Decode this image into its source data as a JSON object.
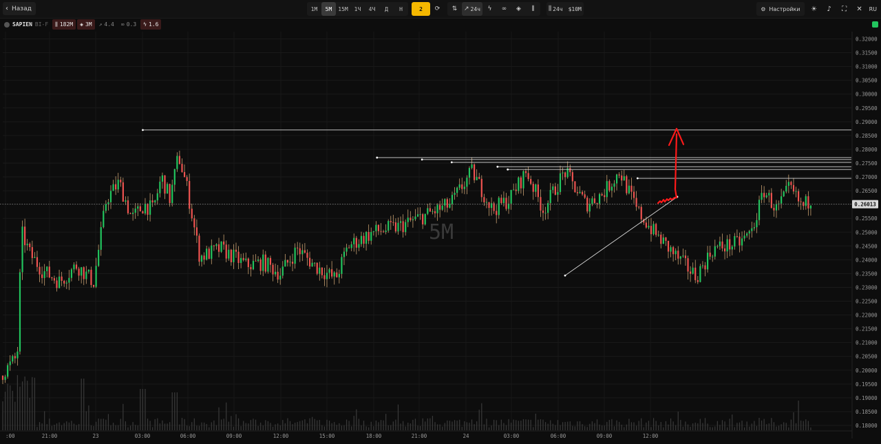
{
  "toolbar": {
    "back_label": "Назад",
    "timeframes": [
      "1М",
      "5М",
      "15М",
      "1Ч",
      "4Ч",
      "Д",
      "Н"
    ],
    "active_timeframe": "5М",
    "accent_label": "2",
    "period_label": "24ч",
    "stats_period": "24ч",
    "stats_volume": "$10M",
    "settings_label": "Настройки",
    "lang_label": "RU"
  },
  "info": {
    "symbol": "SAPIEN",
    "symbol_sub": "BI-F",
    "volume": "182M",
    "oi": "3M",
    "change": "4.4",
    "link_val": "0.3",
    "spark_val": "1.6"
  },
  "chart_data": {
    "type": "candlestick",
    "watermark": "5M",
    "current_price": "0.26013",
    "price_ticks": [
      "0.32000",
      "0.31500",
      "0.31000",
      "0.30500",
      "0.30000",
      "0.29500",
      "0.29000",
      "0.28500",
      "0.28000",
      "0.27500",
      "0.27000",
      "0.26500",
      "0.26000",
      "0.25500",
      "0.25000",
      "0.24500",
      "0.24000",
      "0.23500",
      "0.23000",
      "0.22500",
      "0.22000",
      "0.21500",
      "0.21000",
      "0.20500",
      "0.20000",
      "0.19500",
      "0.19000",
      "0.18500",
      "0.18000"
    ],
    "time_ticks": [
      ":00",
      "21:00",
      "23",
      "03:00",
      "06:00",
      "09:00",
      "12:00",
      "15:00",
      "18:00",
      "21:00",
      "24",
      "03:00",
      "06:00",
      "09:00",
      "12:00"
    ],
    "price_path": [
      [
        0.0,
        0.198
      ],
      [
        0.012,
        0.202
      ],
      [
        0.02,
        0.205
      ],
      [
        0.025,
        0.25
      ],
      [
        0.035,
        0.242
      ],
      [
        0.05,
        0.236
      ],
      [
        0.07,
        0.232
      ],
      [
        0.09,
        0.238
      ],
      [
        0.11,
        0.232
      ],
      [
        0.125,
        0.262
      ],
      [
        0.14,
        0.268
      ],
      [
        0.155,
        0.255
      ],
      [
        0.17,
        0.26
      ],
      [
        0.18,
        0.258
      ],
      [
        0.19,
        0.27
      ],
      [
        0.2,
        0.262
      ],
      [
        0.21,
        0.278
      ],
      [
        0.22,
        0.266
      ],
      [
        0.235,
        0.241
      ],
      [
        0.26,
        0.244
      ],
      [
        0.29,
        0.238
      ],
      [
        0.31,
        0.239
      ],
      [
        0.33,
        0.235
      ],
      [
        0.35,
        0.244
      ],
      [
        0.37,
        0.238
      ],
      [
        0.395,
        0.233
      ],
      [
        0.41,
        0.245
      ],
      [
        0.44,
        0.25
      ],
      [
        0.47,
        0.252
      ],
      [
        0.5,
        0.256
      ],
      [
        0.53,
        0.26
      ],
      [
        0.556,
        0.272
      ],
      [
        0.58,
        0.258
      ],
      [
        0.6,
        0.262
      ],
      [
        0.62,
        0.272
      ],
      [
        0.64,
        0.258
      ],
      [
        0.665,
        0.272
      ],
      [
        0.69,
        0.26
      ],
      [
        0.71,
        0.264
      ],
      [
        0.73,
        0.272
      ],
      [
        0.75,
        0.258
      ],
      [
        0.77,
        0.25
      ],
      [
        0.8,
        0.24
      ],
      [
        0.82,
        0.234
      ],
      [
        0.84,
        0.244
      ],
      [
        0.87,
        0.246
      ],
      [
        0.885,
        0.25
      ],
      [
        0.9,
        0.265
      ],
      [
        0.915,
        0.258
      ],
      [
        0.93,
        0.266
      ],
      [
        0.945,
        0.259
      ],
      [
        0.955,
        0.262
      ]
    ],
    "ylim": [
      0.18,
      0.32
    ],
    "levels": [
      0.287,
      0.277,
      0.2763,
      0.2753,
      0.2737,
      0.2727,
      0.2695
    ],
    "colors": {
      "up": "#22c55e",
      "down": "#ef5350",
      "wick": "#c8a070",
      "arrow": "#ff1a1a"
    }
  }
}
